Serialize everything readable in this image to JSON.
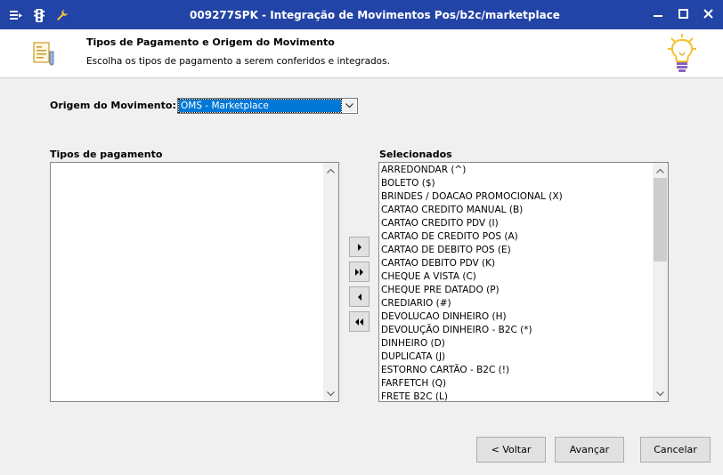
{
  "window": {
    "title": "009277SPK - Integração de Movimentos Pos/b2c/marketplace",
    "title_color": "#2244a6",
    "icons": [
      "menu-icon",
      "traffic-light-icon",
      "wrench-icon"
    ],
    "controls": [
      "minimize-icon",
      "maximize-icon",
      "close-icon"
    ]
  },
  "header": {
    "title": "Tipos de Pagamento e Origem do Movimento",
    "subtitle": "Escolha os tipos de pagamento a serem conferidos e integrados.",
    "left_icon": "document-icon",
    "right_icon": "lightbulb-icon"
  },
  "origem": {
    "label": "Origem do Movimento:",
    "value": "OMS - Marketplace",
    "selection_color": "#0078d7"
  },
  "tipos": {
    "label": "Tipos de pagamento",
    "items": []
  },
  "selecionados": {
    "label": "Selecionados",
    "items": [
      "ARREDONDAR (^)",
      "BOLETO ($)",
      "BRINDES / DOACAO PROMOCIONAL (X)",
      "CARTAO CREDITO MANUAL (B)",
      "CARTAO CREDITO PDV (I)",
      "CARTAO DE CREDITO POS (A)",
      "CARTAO DE DEBITO POS (E)",
      "CARTAO DEBITO PDV (K)",
      "CHEQUE A VISTA (C)",
      "CHEQUE PRE DATADO (P)",
      "CREDIARIO (#)",
      "DEVOLUCAO DINHEIRO (H)",
      "DEVOLUÇÃO DINHEIRO - B2C (*)",
      "DINHEIRO (D)",
      "DUPLICATA (J)",
      "ESTORNO CARTÃO - B2C (!)",
      "FARFETCH (Q)",
      "FRETE B2C (L)"
    ]
  },
  "move_buttons": {
    "add_one": "›",
    "add_all": "»",
    "remove_one": "‹",
    "remove_all": "«"
  },
  "footer": {
    "back": "< Voltar",
    "next": "Avançar",
    "cancel": "Cancelar"
  }
}
